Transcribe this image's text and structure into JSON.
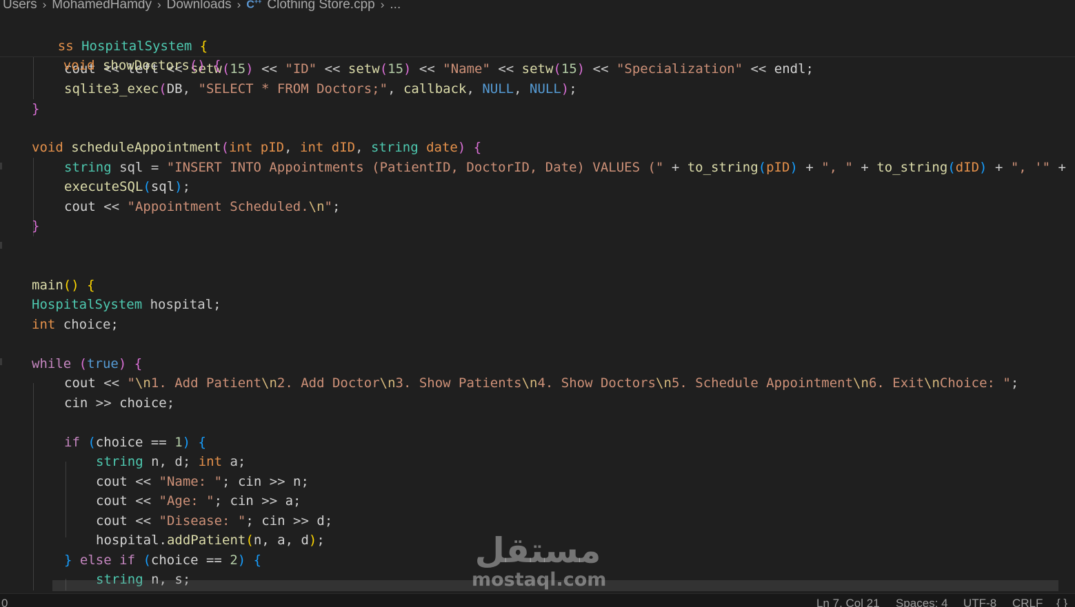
{
  "breadcrumb": {
    "items": [
      "Users",
      "MohamedHamdy",
      "Downloads"
    ],
    "file_icon": "C++",
    "file_name": "Clothing Store.cpp",
    "trailing": "..."
  },
  "sticky": {
    "line1": {
      "prefix": "ss",
      "class_name": "HospitalSystem",
      "brace": "{"
    },
    "line2": {
      "kw": "void",
      "fn": "showDoctors",
      "rest": "()",
      "brace": "{"
    }
  },
  "code": {
    "l1": {
      "a": "cout",
      "b": " << ",
      "c": "left",
      "d": " << ",
      "e": "setw",
      "f": "(",
      "g": "15",
      "h": ")",
      "i": " << ",
      "j": "\"ID\"",
      "k": " << ",
      "l": "setw",
      "m": "(",
      "n": "15",
      "o": ")",
      "p": " << ",
      "q": "\"Name\"",
      "r": " << ",
      "s": "setw",
      "t": "(",
      "u": "15",
      "v": ")",
      "w": " << ",
      "x": "\"Specialization\"",
      "y": " << ",
      "z": "endl",
      "end": ";"
    },
    "l2": {
      "a": "sqlite3_exec",
      "b": "(",
      "c": "DB",
      "d": ", ",
      "e": "\"SELECT * FROM Doctors;\"",
      "f": ", ",
      "g": "callback",
      "h": ", ",
      "i": "NULL",
      "j": ", ",
      "k": "NULL",
      "l": ")",
      "end": ";"
    },
    "l3": "}",
    "l5": {
      "a": "void",
      "b": " ",
      "c": "scheduleAppointment",
      "d": "(",
      "e": "int",
      "f": " ",
      "g": "pID",
      "h": ", ",
      "i": "int",
      "j": " ",
      "k": "dID",
      "l": ", ",
      "m": "string",
      "n": " ",
      "o": "date",
      "p": ")",
      "q": " ",
      "r": "{"
    },
    "l6": {
      "a": "string",
      "b": " sql = ",
      "c": "\"INSERT INTO Appointments (PatientID, DoctorID, Date) VALUES (\"",
      "d": " + ",
      "e": "to_string",
      "f": "(",
      "g": "pID",
      "h": ")",
      "i": " + ",
      "j": "\", \"",
      "k": " + ",
      "l": "to_string",
      "m": "(",
      "n": "dID",
      "o": ")",
      "p": " + ",
      "q": "\", '\"",
      "r": " +"
    },
    "l7": {
      "a": "executeSQL",
      "b": "(",
      "c": "sql",
      "d": ")",
      "end": ";"
    },
    "l8": {
      "a": "cout",
      "b": " << ",
      "c": "\"Appointment Scheduled.",
      "d": "\\n",
      "e": "\"",
      "end": ";"
    },
    "l9": "}",
    "l12": {
      "a": "main",
      "b": "()",
      "c": " ",
      "d": "{"
    },
    "l13": {
      "a": "HospitalSystem",
      "b": " hospital;"
    },
    "l14": {
      "a": "int",
      "b": " choice;"
    },
    "l16": {
      "a": "while",
      "b": " ",
      "c": "(",
      "d": "true",
      "e": ")",
      "f": " ",
      "g": "{"
    },
    "l17": {
      "a": "cout",
      "b": " << ",
      "c": "\"",
      "d": "\\n",
      "e": "1. Add Patient",
      "f": "\\n",
      "g": "2. Add Doctor",
      "h": "\\n",
      "i": "3. Show Patients",
      "j": "\\n",
      "k": "4. Show Doctors",
      "l": "\\n",
      "m": "5. Schedule Appointment",
      "n": "\\n",
      "o": "6. Exit",
      "p": "\\n",
      "q": "Choice: \"",
      "end": ";"
    },
    "l18": {
      "a": "cin",
      "b": " >> ",
      "c": "choice",
      "end": ";"
    },
    "l20": {
      "a": "if",
      "b": " ",
      "c": "(",
      "d": "choice == ",
      "e": "1",
      "f": ")",
      "g": " ",
      "h": "{"
    },
    "l21": {
      "a": "string",
      "b": " n, d; ",
      "c": "int",
      "d": " a;"
    },
    "l22": {
      "a": "cout",
      "b": " << ",
      "c": "\"Name: \"",
      "d": "; ",
      "e": "cin",
      "f": " >> ",
      "g": "n",
      "end": ";"
    },
    "l23": {
      "a": "cout",
      "b": " << ",
      "c": "\"Age: \"",
      "d": "; ",
      "e": "cin",
      "f": " >> ",
      "g": "a",
      "end": ";"
    },
    "l24": {
      "a": "cout",
      "b": " << ",
      "c": "\"Disease: \"",
      "d": "; ",
      "e": "cin",
      "f": " >> ",
      "g": "d",
      "end": ";"
    },
    "l25": {
      "a": "hospital",
      "b": ".",
      "c": "addPatient",
      "d": "(",
      "e": "n, a, d",
      "f": ")",
      "end": ";"
    },
    "l26": {
      "a": "}",
      "b": " ",
      "c": "else",
      "d": " ",
      "e": "if",
      "f": " ",
      "g": "(",
      "h": "choice == ",
      "i": "2",
      "j": ")",
      "k": " ",
      "l": "{"
    },
    "l27": {
      "a": "string",
      "b": " n, s;"
    }
  },
  "statusbar": {
    "left": "0",
    "ln_col": "Ln 7, Col 21",
    "spaces": "Spaces: 4",
    "encoding": "UTF-8",
    "eol": "CRLF",
    "lang": "{ }"
  },
  "watermark": {
    "arabic": "مستقل",
    "latin": "mostaql.com"
  },
  "colors": {
    "background": "#1f1f1f",
    "keyword": "#e5914b",
    "function": "#dcdcaa",
    "type": "#4ec9b0",
    "string": "#ce9178",
    "number": "#b5cea8",
    "macro": "#569cd6"
  }
}
